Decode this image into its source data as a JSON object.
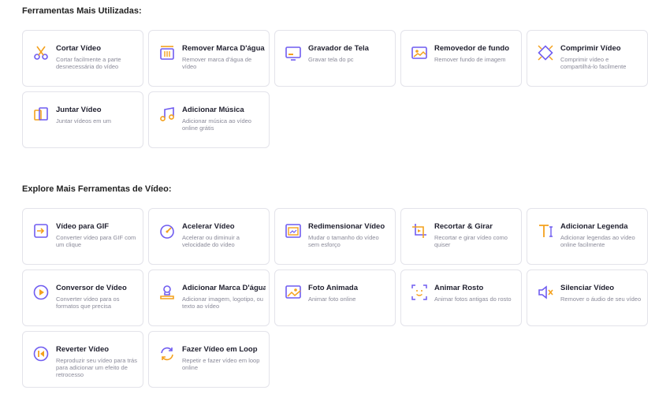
{
  "sections": [
    {
      "title": "Ferramentas Mais Utilizadas:",
      "tools": [
        {
          "id": "cortar-video",
          "icon": "scissors-icon",
          "title": "Cortar Vídeo",
          "desc": "Cortar facilmente a parte desnecessária do vídeo"
        },
        {
          "id": "remover-marca-dagua",
          "icon": "eraser-icon",
          "title": "Remover Marca D'água",
          "desc": "Remover marca d'água de vídeo"
        },
        {
          "id": "gravador-de-tela",
          "icon": "screen-record-icon",
          "title": "Gravador de Tela",
          "desc": "Gravar tela do pc"
        },
        {
          "id": "removedor-de-fundo",
          "icon": "image-background-icon",
          "title": "Removedor de fundo",
          "desc": "Remover fundo de imagem"
        },
        {
          "id": "comprimir-video",
          "icon": "compress-icon",
          "title": "Comprimir Vídeo",
          "desc": "Comprimir vídeo e compartilhá-lo facilmente"
        },
        {
          "id": "juntar-video",
          "icon": "merge-icon",
          "title": "Juntar Vídeo",
          "desc": "Juntar vídeos em um"
        },
        {
          "id": "adicionar-musica",
          "icon": "music-note-icon",
          "title": "Adicionar Música",
          "desc": "Adicionar música ao vídeo online grátis"
        }
      ]
    },
    {
      "title": "Explore Mais Ferramentas de Vídeo:",
      "tools": [
        {
          "id": "video-para-gif",
          "icon": "gif-convert-icon",
          "title": "Vídeo para GIF",
          "desc": "Converter vídeo para GIF com um clique"
        },
        {
          "id": "acelerar-video",
          "icon": "speedometer-icon",
          "title": "Acelerar Vídeo",
          "desc": "Acelerar ou diminuir a velocidade do vídeo"
        },
        {
          "id": "redimensionar-video",
          "icon": "resize-icon",
          "title": "Redimensionar Vídeo",
          "desc": "Mudar o tamanho do vídeo sem esforço"
        },
        {
          "id": "recortar-girar",
          "icon": "crop-rotate-icon",
          "title": "Recortar & Girar",
          "desc": "Recortar e girar vídeo como quiser"
        },
        {
          "id": "adicionar-legenda",
          "icon": "text-caption-icon",
          "title": "Adicionar Legenda",
          "desc": "Adicionar legendas ao vídeo online facilmente"
        },
        {
          "id": "conversor-de-video",
          "icon": "convert-play-icon",
          "title": "Conversor de Vídeo",
          "desc": "Converter vídeo para os formatos que precisa"
        },
        {
          "id": "adicionar-marca-dagua",
          "icon": "stamp-icon",
          "title": "Adicionar Marca D'água",
          "desc": "Adicionar imagem, logotipo, ou texto ao vídeo"
        },
        {
          "id": "foto-animada",
          "icon": "animated-photo-icon",
          "title": "Foto Animada",
          "desc": "Animar foto online"
        },
        {
          "id": "animar-rosto",
          "icon": "face-scan-icon",
          "title": "Animar Rosto",
          "desc": "Animar fotos antigas do rosto"
        },
        {
          "id": "silenciar-video",
          "icon": "mute-icon",
          "title": "Silenciar Vídeo",
          "desc": "Remover o áudio de seu vídeo"
        },
        {
          "id": "reverter-video",
          "icon": "rewind-icon",
          "title": "Reverter Vídeo",
          "desc": "Reproduzir seu vídeo para trás para adicionar um efeito de retrocesso"
        },
        {
          "id": "fazer-video-em-loop",
          "icon": "loop-icon",
          "title": "Fazer Vídeo em Loop",
          "desc": "Repetir e fazer vídeo em loop online"
        }
      ]
    }
  ],
  "colors": {
    "icon_primary": "#6f5cf0",
    "icon_accent": "#f4a11d",
    "border": "#e3e3ea",
    "desc_text": "#8a8a99"
  }
}
